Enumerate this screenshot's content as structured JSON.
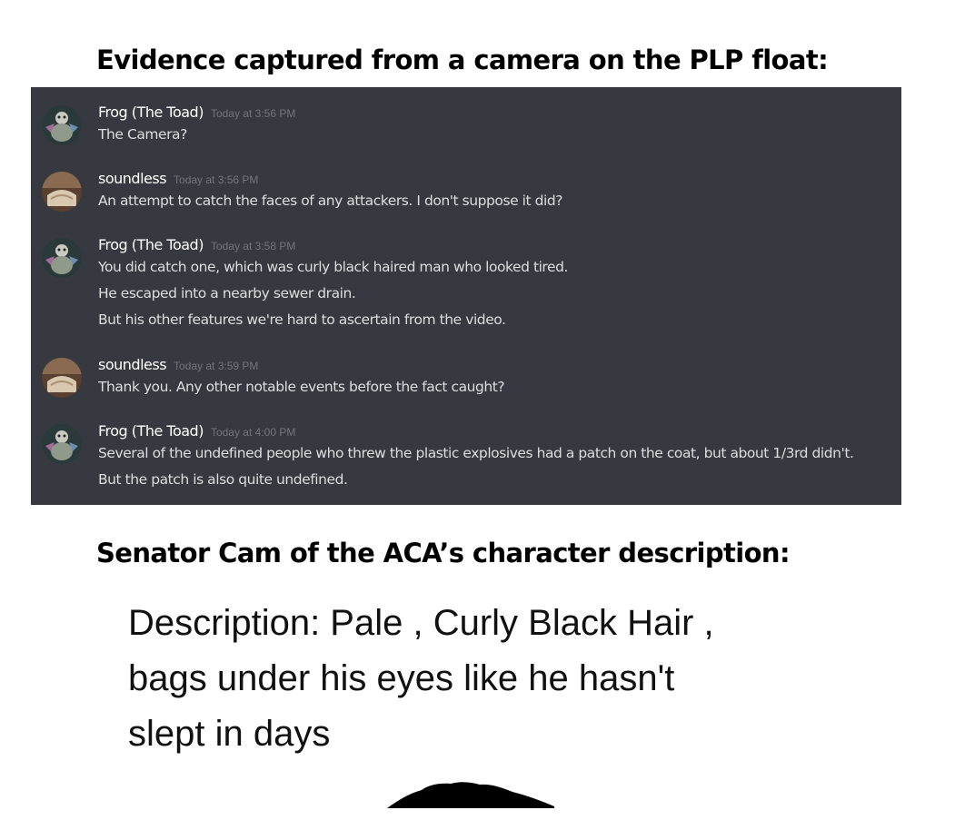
{
  "heading_top": "Evidence captured from a camera on the PLP float:",
  "heading_bottom": "Senator Cam of the ACA’s character description:",
  "chat": {
    "messages": [
      {
        "username": "Frog (The Toad)",
        "timestamp": "Today at 3:56 PM",
        "avatar_icon": "frog-avatar-icon",
        "lines": [
          "The Camera?"
        ]
      },
      {
        "username": "soundless",
        "timestamp": "Today at 3:56 PM",
        "avatar_icon": "soundless-avatar-icon",
        "lines": [
          "An attempt to catch the faces of any attackers. I don't suppose it did?"
        ]
      },
      {
        "username": "Frog (The Toad)",
        "timestamp": "Today at 3:58 PM",
        "avatar_icon": "frog-avatar-icon",
        "lines": [
          "You did catch one, which was curly black haired man who looked tired.",
          "He escaped into a nearby sewer drain.",
          "But his other features we're hard to ascertain from the video."
        ]
      },
      {
        "username": "soundless",
        "timestamp": "Today at 3:59 PM",
        "avatar_icon": "soundless-avatar-icon",
        "lines": [
          "Thank you. Any other notable events before the fact caught?"
        ]
      },
      {
        "username": "Frog (The Toad)",
        "timestamp": "Today at 4:00 PM",
        "avatar_icon": "frog-avatar-icon",
        "lines": [
          "Several of the undefined people who threw the plastic explosives had a patch on the coat, but about 1/3rd didn't.",
          "But the patch is also quite undefined."
        ]
      }
    ]
  },
  "description": {
    "lines": [
      "Description: Pale , Curly Black Hair ,",
      "bags under his eyes like he hasn't",
      "slept in days"
    ]
  },
  "colors": {
    "chat_background": "#36393f",
    "username": "#ffffff",
    "timestamp": "#72767d",
    "message_text": "#dcddde"
  }
}
